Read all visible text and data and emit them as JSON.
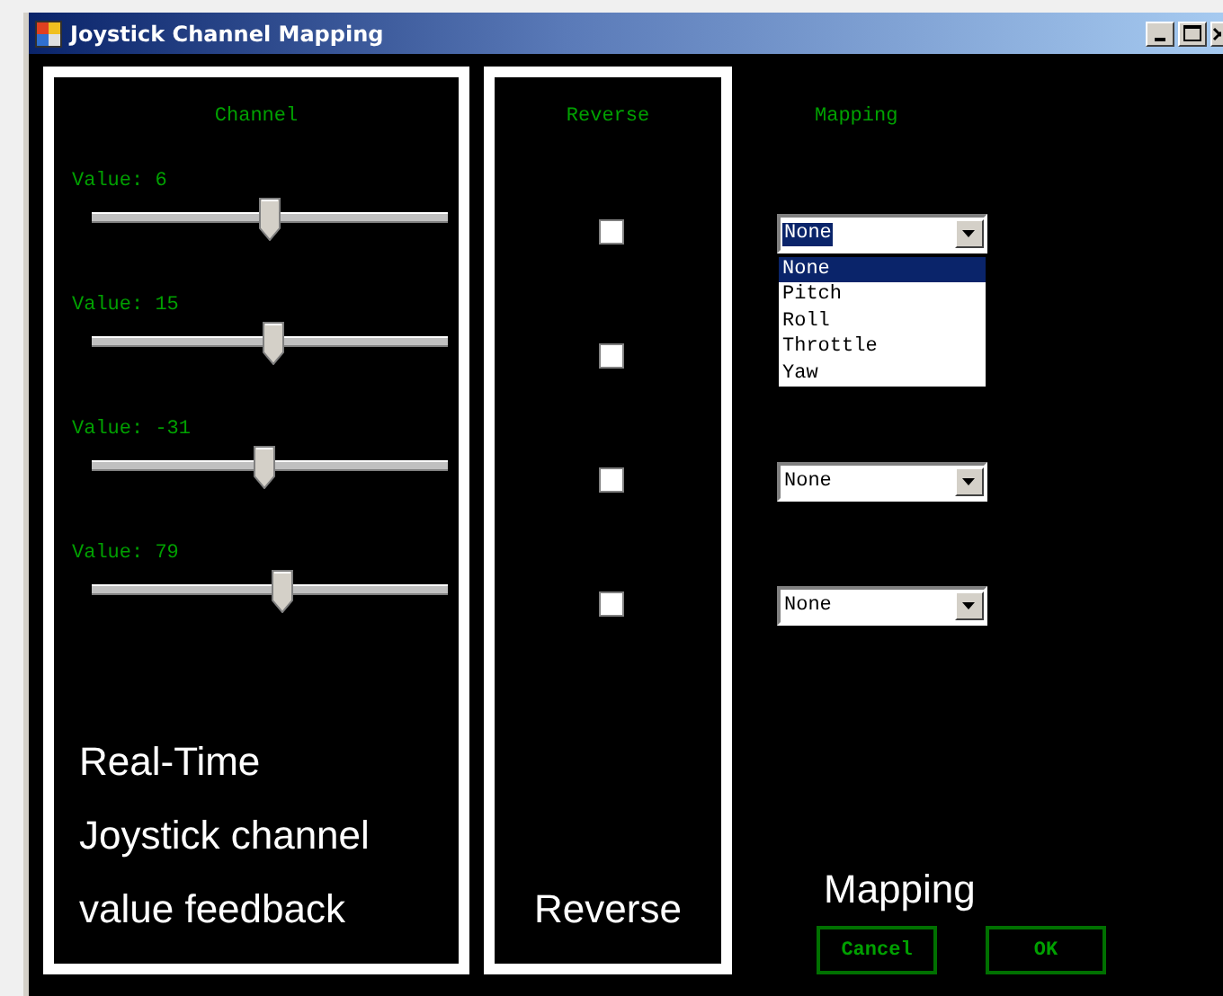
{
  "window": {
    "title": "Joystick Channel Mapping"
  },
  "headers": {
    "channel": "Channel",
    "reverse": "Reverse",
    "mapping": "Mapping"
  },
  "channels": [
    {
      "value_label": "Value: 6",
      "level": 0.5,
      "reversed": false,
      "mapping": {
        "value": "None",
        "focused": true,
        "open": true
      }
    },
    {
      "value_label": "Value: 15",
      "level": 0.51,
      "reversed": false
    },
    {
      "value_label": "Value: -31",
      "level": 0.485,
      "reversed": false,
      "mapping": {
        "value": "None"
      }
    },
    {
      "value_label": "Value: 79",
      "level": 0.535,
      "reversed": false,
      "mapping": {
        "value": "None"
      }
    }
  ],
  "dropdown_options": [
    {
      "label": "None",
      "selected": true
    },
    {
      "label": "Pitch",
      "selected": false
    },
    {
      "label": "Roll",
      "selected": false
    },
    {
      "label": "Throttle",
      "selected": false
    },
    {
      "label": "Yaw",
      "selected": false
    }
  ],
  "annotations": {
    "channel": [
      "Real-Time",
      "Joystick channel",
      "value feedback"
    ],
    "reverse": "Reverse",
    "mapping": "Mapping"
  },
  "buttons": [
    {
      "label": "Cancel"
    },
    {
      "label": "OK"
    }
  ]
}
